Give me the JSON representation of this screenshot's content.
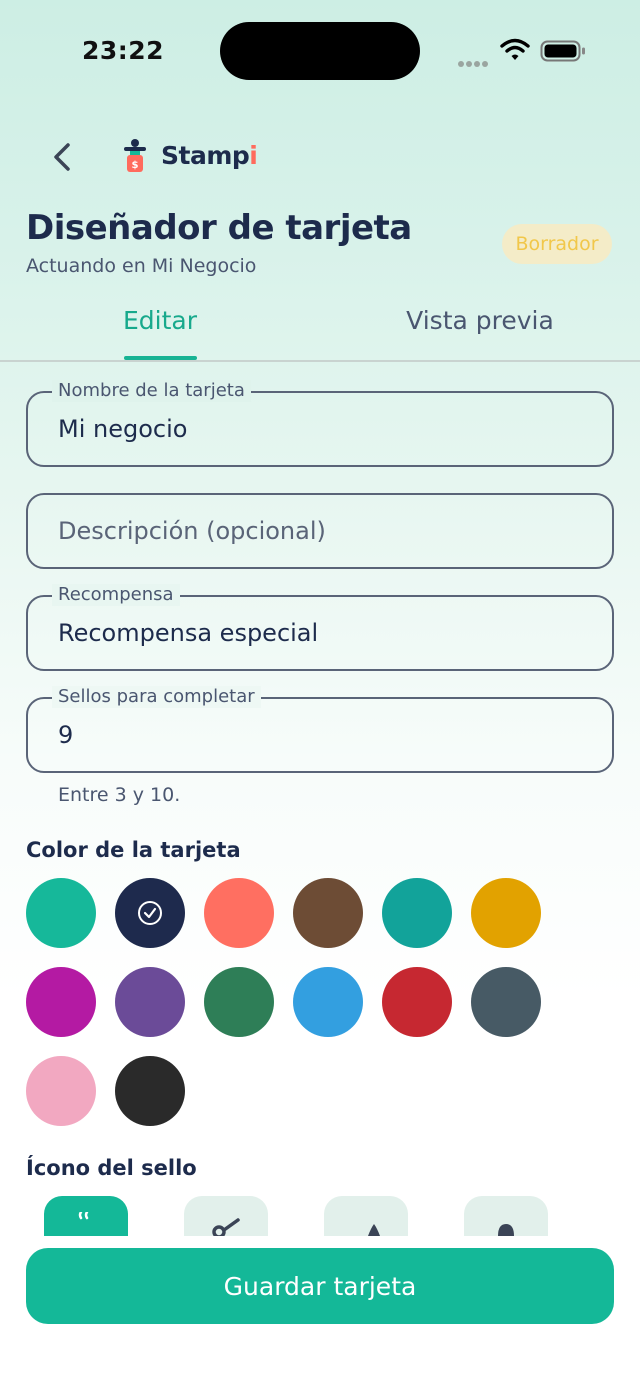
{
  "status_bar": {
    "time": "23:22"
  },
  "header": {
    "brand_prefix": "Stamp",
    "brand_suffix": "i",
    "title": "Diseñador de tarjeta",
    "subtitle": "Actuando en Mi Negocio",
    "badge": "Borrador"
  },
  "tabs": [
    {
      "label": "Editar",
      "active": true
    },
    {
      "label": "Vista previa",
      "active": false
    }
  ],
  "form": {
    "name": {
      "label": "Nombre de la tarjeta",
      "value": "Mi negocio"
    },
    "description": {
      "placeholder": "Descripción (opcional)",
      "value": ""
    },
    "reward": {
      "label": "Recompensa",
      "value": "Recompensa especial"
    },
    "stamps": {
      "label": "Sellos para completar",
      "value": "9",
      "helper": "Entre 3 y 10."
    }
  },
  "card_color": {
    "label": "Color de la tarjeta",
    "selected_index": 1,
    "swatches": [
      "#16b89a",
      "#1e2a4d",
      "#ff6f61",
      "#6d4c35",
      "#12a39a",
      "#e2a200",
      "#b41aa3",
      "#6b4b98",
      "#2e7e57",
      "#339fe0",
      "#c62831",
      "#475a65",
      "#f2a8c1",
      "#2a2a2a"
    ]
  },
  "stamp_icon": {
    "label": "Ícono del sello",
    "options": [
      {
        "icon": "coffee-icon",
        "selected": true
      },
      {
        "icon": "scissors-icon",
        "selected": false
      },
      {
        "icon": "drop-icon",
        "selected": false
      },
      {
        "icon": "bell-icon",
        "selected": false
      }
    ]
  },
  "actions": {
    "save_label": "Guardar tarjeta"
  },
  "colors": {
    "accent": "#14b898",
    "text": "#1d2b4c",
    "badge_bg": "#f4ecc8",
    "badge_text": "#f1c74a"
  }
}
